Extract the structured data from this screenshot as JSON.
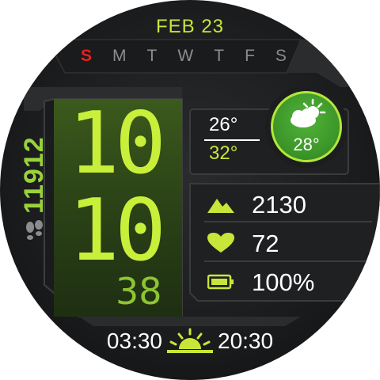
{
  "date": "FEB 23",
  "weekdays": [
    "S",
    "M",
    "T",
    "W",
    "T",
    "F",
    "S"
  ],
  "time": {
    "hours": "10",
    "minutes": "10",
    "seconds": "38"
  },
  "steps": "11912",
  "weather": {
    "low": "26°",
    "high": "32°",
    "current": "28°",
    "icon": "partly-cloudy-icon"
  },
  "stats": {
    "elevation": "2130",
    "heart_rate": "72",
    "battery": "100%"
  },
  "sun": {
    "sunrise": "03:30",
    "sunset": "20:30"
  },
  "colors": {
    "accent": "#c8f03a",
    "sunday": "#e8201e",
    "weather_bg": "#3a9327",
    "text": "#ffffff"
  }
}
